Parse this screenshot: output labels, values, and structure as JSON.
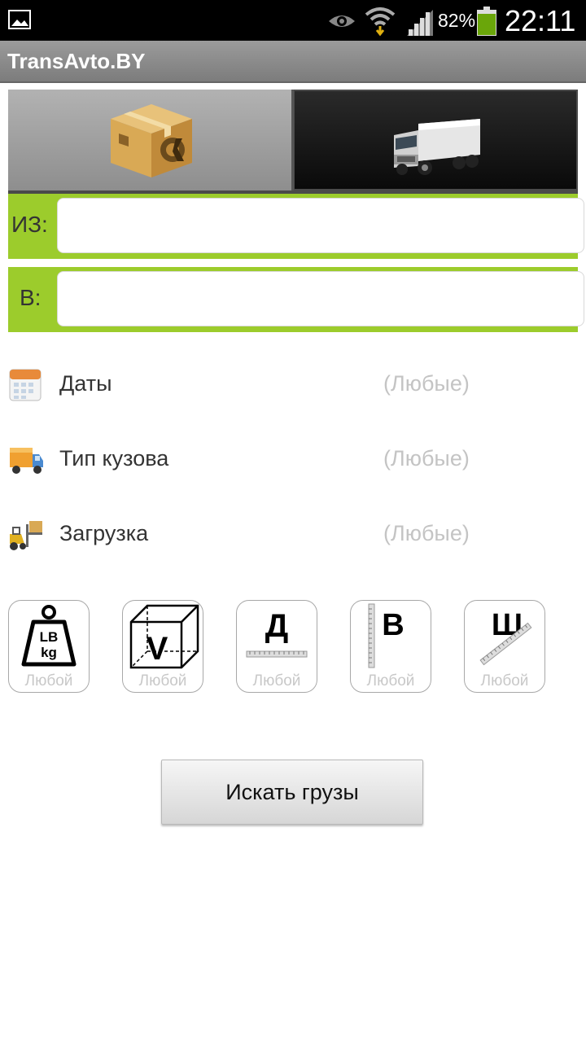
{
  "status_bar": {
    "battery_percent": "82%",
    "time": "22:11",
    "icons": [
      "gallery-icon",
      "eye-icon",
      "wifi-icon",
      "signal-icon",
      "battery-icon"
    ]
  },
  "app": {
    "title": "TransAvto.BY"
  },
  "tabs": [
    {
      "name": "cargo",
      "icon": "cargo-box-icon",
      "selected": true
    },
    {
      "name": "truck",
      "icon": "truck-icon",
      "selected": false
    }
  ],
  "route": {
    "from_label": "ИЗ:",
    "from_value": "",
    "to_label": "В:",
    "to_value": ""
  },
  "filters": [
    {
      "label": "Даты",
      "value": "(Любые)",
      "icon": "calendar-icon"
    },
    {
      "label": "Тип кузова",
      "value": "(Любые)",
      "icon": "truck-body-icon"
    },
    {
      "label": "Загрузка",
      "value": "(Любые)",
      "icon": "forklift-icon"
    }
  ],
  "params": [
    {
      "glyph": "LB\nkg",
      "caption": "Любой",
      "icon": "weight-icon"
    },
    {
      "glyph": "V",
      "caption": "Любой",
      "icon": "volume-icon"
    },
    {
      "glyph": "Д",
      "caption": "Любой",
      "icon": "length-icon"
    },
    {
      "glyph": "В",
      "caption": "Любой",
      "icon": "height-icon"
    },
    {
      "glyph": "Ш",
      "caption": "Любой",
      "icon": "width-icon"
    }
  ],
  "weight_glyph": {
    "top": "LB",
    "bottom": "kg"
  },
  "search_button": "Искать грузы",
  "colors": {
    "accent_green": "#9ccc2c",
    "title_bar": "#8c8c8c",
    "placeholder_gray": "#c4c4c4"
  }
}
